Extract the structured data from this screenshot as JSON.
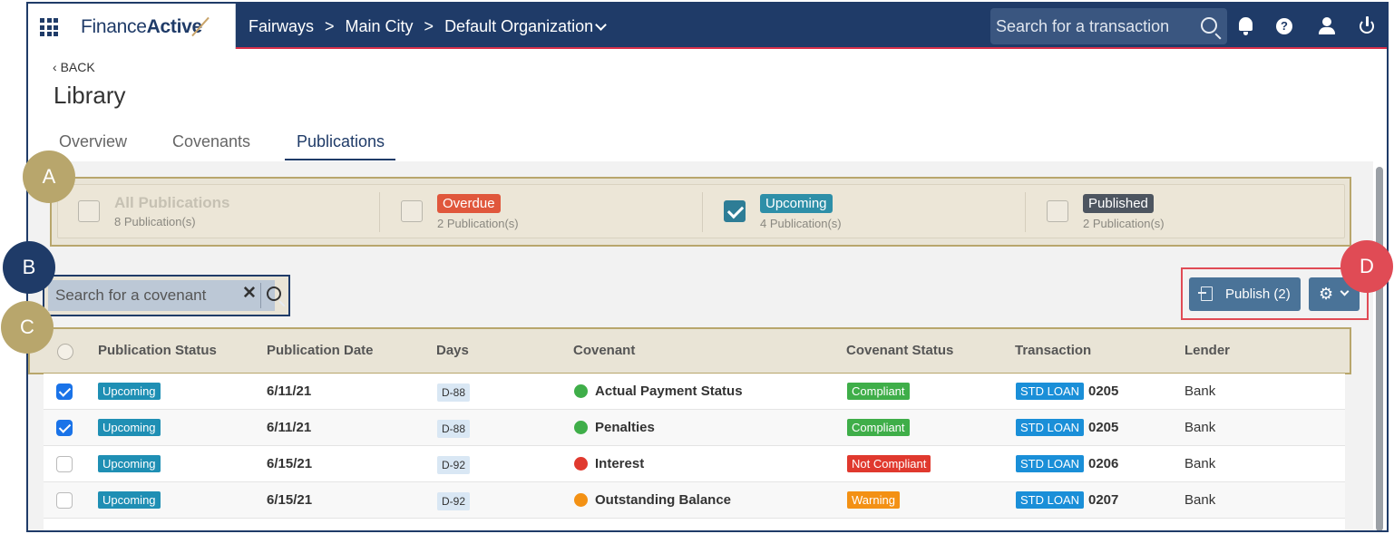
{
  "header": {
    "brand_regular": "Finance",
    "brand_bold": "Active",
    "crumbs": [
      "Fairways",
      "Main City",
      "Default Organization"
    ],
    "search_placeholder": "Search for a transaction",
    "icons": [
      "bell-icon",
      "help-icon",
      "user-icon",
      "power-icon"
    ]
  },
  "page": {
    "back": "BACK",
    "title": "Library",
    "tabs": [
      {
        "label": "Overview",
        "active": false
      },
      {
        "label": "Covenants",
        "active": false
      },
      {
        "label": "Publications",
        "active": true
      }
    ]
  },
  "filters": [
    {
      "label": "All Publications",
      "count": "8 Publication(s)",
      "checked": false,
      "color": ""
    },
    {
      "label": "Overdue",
      "count": "2 Publication(s)",
      "checked": false,
      "color": "#e0573c"
    },
    {
      "label": "Upcoming",
      "count": "4 Publication(s)",
      "checked": true,
      "color": "#2e8fa8"
    },
    {
      "label": "Published",
      "count": "2 Publication(s)",
      "checked": false,
      "color": "#4d5560"
    }
  ],
  "search": {
    "placeholder": "Search for a covenant"
  },
  "actions": {
    "publish_label": "Publish (2)"
  },
  "annotations": [
    "A",
    "B",
    "C",
    "D"
  ],
  "table": {
    "headers": [
      "Publication Status",
      "Publication Date",
      "Days",
      "Covenant",
      "Covenant Status",
      "Transaction",
      "Lender"
    ],
    "rows": [
      {
        "checked": true,
        "status": "Upcoming",
        "date": "6/11/21",
        "days": "D-88",
        "dot": "#3fae49",
        "covenant": "Actual Payment Status",
        "cov_status": "Compliant",
        "cov_color": "#3fae49",
        "tx_type": "STD LOAN",
        "tx_num": "0205",
        "lender": "Bank"
      },
      {
        "checked": true,
        "status": "Upcoming",
        "date": "6/11/21",
        "days": "D-88",
        "dot": "#3fae49",
        "covenant": "Penalties",
        "cov_status": "Compliant",
        "cov_color": "#3fae49",
        "tx_type": "STD LOAN",
        "tx_num": "0205",
        "lender": "Bank"
      },
      {
        "checked": false,
        "status": "Upcoming",
        "date": "6/15/21",
        "days": "D-92",
        "dot": "#e0392e",
        "covenant": "Interest",
        "cov_status": "Not Compliant",
        "cov_color": "#e0392e",
        "tx_type": "STD LOAN",
        "tx_num": "0206",
        "lender": "Bank"
      },
      {
        "checked": false,
        "status": "Upcoming",
        "date": "6/15/21",
        "days": "D-92",
        "dot": "#f39114",
        "covenant": "Outstanding Balance",
        "cov_status": "Warning",
        "cov_color": "#f39114",
        "tx_type": "STD LOAN",
        "tx_num": "0207",
        "lender": "Bank"
      }
    ]
  },
  "colors": {
    "navy": "#1f3b68",
    "gold_annotation": "#b8a66c",
    "red_annotation": "#e04b55"
  }
}
